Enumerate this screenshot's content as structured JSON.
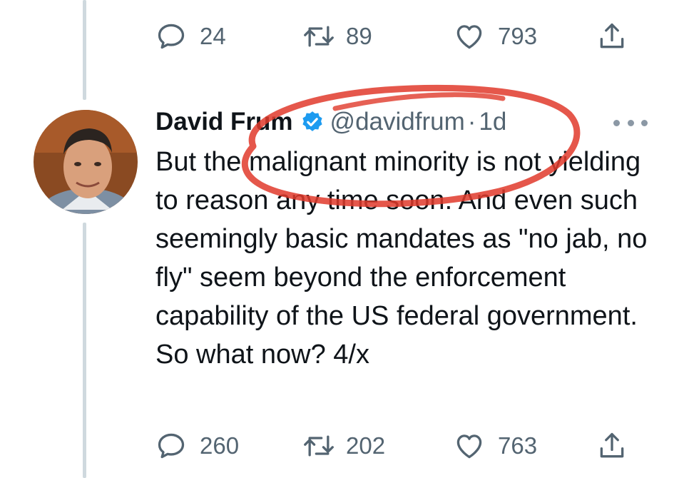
{
  "top_tweet": {
    "actions": {
      "reply_count": "24",
      "retweet_count": "89",
      "like_count": "793"
    }
  },
  "tweet": {
    "author_name": "David Frum",
    "handle": "@davidfrum",
    "separator": "·",
    "time": "1d",
    "text": "But the malignant minority is not yielding to reason any time soon. And even such seemingly basic mandates as \"no jab, no fly\" seem beyond the enforcement capability of the US federal government. So what now? 4/x",
    "actions": {
      "reply_count": "260",
      "retweet_count": "202",
      "like_count": "763"
    }
  },
  "colors": {
    "text_primary": "#0f1419",
    "text_secondary": "#536471",
    "verified_blue": "#1d9bf0",
    "thread_line": "#cfd9de",
    "annotation_red": "#e0392b"
  },
  "icons": [
    "reply-icon",
    "retweet-icon",
    "like-icon",
    "share-icon",
    "verified-badge-icon",
    "more-options-icon"
  ]
}
